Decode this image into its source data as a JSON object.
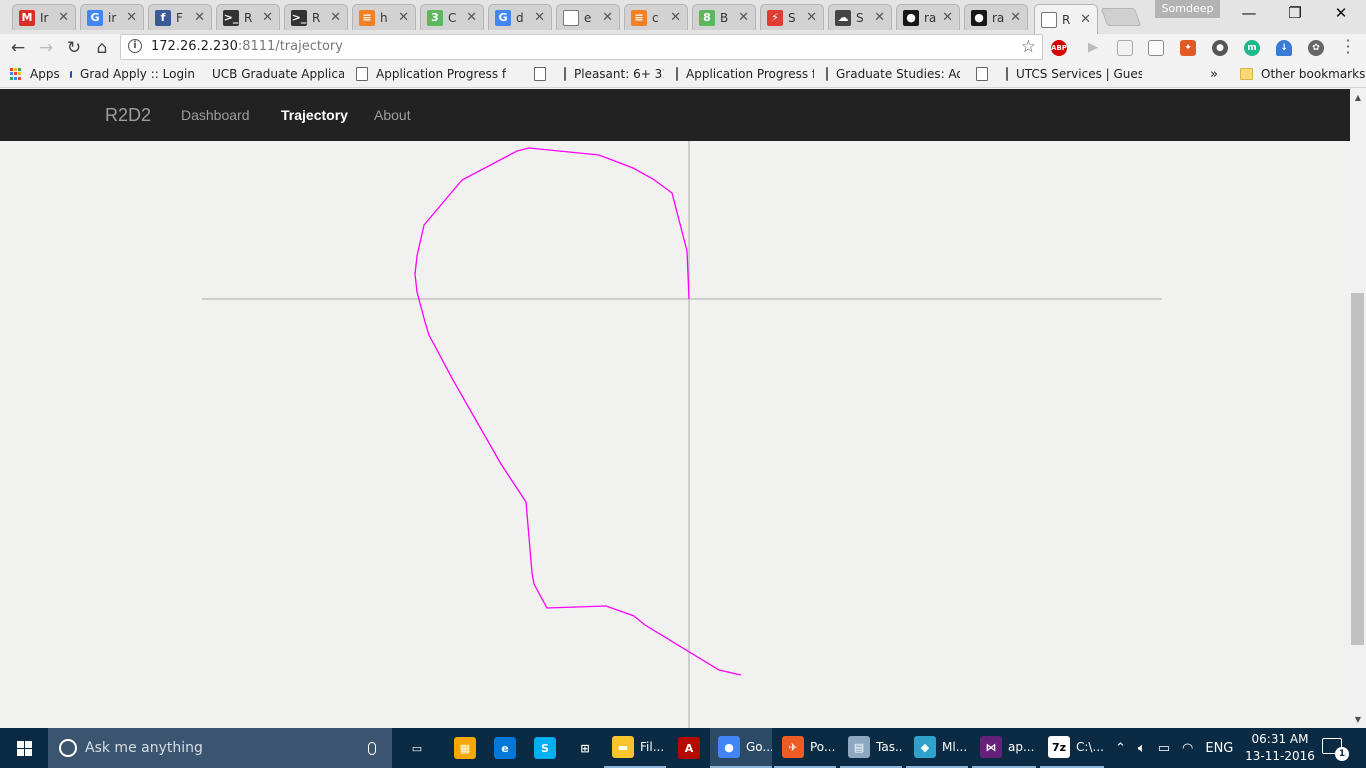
{
  "browser": {
    "tabs": [
      {
        "title": "Ir",
        "icon": "gmail-icon",
        "color": "#d93025",
        "glyph": "M"
      },
      {
        "title": "ir",
        "icon": "google-icon",
        "color": "#4285f4",
        "glyph": "G"
      },
      {
        "title": "F",
        "icon": "facebook-icon",
        "color": "#3b5998",
        "glyph": "f"
      },
      {
        "title": "R",
        "icon": "terminal-icon",
        "color": "#333333",
        "glyph": ">_"
      },
      {
        "title": "R",
        "icon": "terminal-icon",
        "color": "#333333",
        "glyph": ">_"
      },
      {
        "title": "h",
        "icon": "stackoverflow-icon",
        "color": "#f48024",
        "glyph": "≡"
      },
      {
        "title": "C",
        "icon": "codeship-icon",
        "color": "#5cb85c",
        "glyph": "3"
      },
      {
        "title": "d",
        "icon": "google-icon",
        "color": "#4285f4",
        "glyph": "G"
      },
      {
        "title": "e",
        "icon": "page-icon",
        "color": "#ffffff",
        "glyph": ""
      },
      {
        "title": "c",
        "icon": "stackoverflow-icon",
        "color": "#f48024",
        "glyph": "≡"
      },
      {
        "title": "B",
        "icon": "codeship-icon",
        "color": "#5cb85c",
        "glyph": "8"
      },
      {
        "title": "S",
        "icon": "lightning-icon",
        "color": "#e03c31",
        "glyph": "⚡"
      },
      {
        "title": "S",
        "icon": "cloud-icon",
        "color": "#444444",
        "glyph": "☁"
      },
      {
        "title": "ra",
        "icon": "github-icon",
        "color": "#181717",
        "glyph": "●"
      },
      {
        "title": "ra",
        "icon": "github-icon",
        "color": "#181717",
        "glyph": "●"
      },
      {
        "title": "R",
        "icon": "page-icon",
        "color": "#ffffff",
        "glyph": ""
      }
    ],
    "profile": "Somdeep",
    "url_host": "172.26.2.230",
    "url_path": ":8111/trajectory",
    "bookmarks": [
      {
        "label": "Apps",
        "kind": "apps"
      },
      {
        "label": "Grad Apply :: Login",
        "kind": "bird"
      },
      {
        "label": "UCB Graduate Applica",
        "kind": "cap"
      },
      {
        "label": "Application Progress f",
        "kind": "page"
      },
      {
        "label": "",
        "kind": "page"
      },
      {
        "label": "Pleasant: 6+ 31",
        "kind": "page"
      },
      {
        "label": "Application Progress f",
        "kind": "page"
      },
      {
        "label": "Graduate Studies: Adr",
        "kind": "page"
      },
      {
        "label": "",
        "kind": "page"
      },
      {
        "label": "UTCS Services | Guest",
        "kind": "page"
      }
    ],
    "bookmarks_overflow": "»",
    "other_bookmarks": "Other bookmarks"
  },
  "app": {
    "brand": "R2D2",
    "nav": [
      {
        "label": "Dashboard",
        "active": false
      },
      {
        "label": "Trajectory",
        "active": true
      },
      {
        "label": "About",
        "active": false
      }
    ]
  },
  "trajectory": {
    "stroke_color": "#ff00ff",
    "axis_color": "#aaaaaa",
    "points": [
      [
        0,
        0
      ],
      [
        -2,
        -48
      ],
      [
        -17,
        -106
      ],
      [
        -36,
        -120
      ],
      [
        -56,
        -131
      ],
      [
        -90,
        -144
      ],
      [
        -160,
        -151
      ],
      [
        -172,
        -148
      ],
      [
        -227,
        -119
      ],
      [
        -265,
        -74
      ],
      [
        -272,
        -43
      ],
      [
        -274,
        -25
      ],
      [
        -272,
        -7
      ],
      [
        -264,
        23
      ],
      [
        -260,
        36
      ],
      [
        -236,
        81
      ],
      [
        -188,
        165
      ],
      [
        -163,
        203
      ],
      [
        -157,
        274
      ],
      [
        -155,
        285
      ],
      [
        -142,
        309
      ],
      [
        -83,
        307
      ],
      [
        -55,
        317
      ],
      [
        -44,
        326
      ],
      [
        30,
        371
      ],
      [
        52,
        376
      ]
    ]
  },
  "taskbar": {
    "search_placeholder": "Ask me anything",
    "apps": [
      {
        "label": "",
        "icon": "task-view-icon",
        "color": "#0b2a43",
        "glyph": "▭"
      },
      {
        "label": "",
        "icon": "store-icon",
        "color": "#f8a800",
        "glyph": "▦"
      },
      {
        "label": "",
        "icon": "edge-icon",
        "color": "#0078d7",
        "glyph": "e"
      },
      {
        "label": "",
        "icon": "skype-icon",
        "color": "#00aff0",
        "glyph": "S"
      },
      {
        "label": "",
        "icon": "windows-store-icon",
        "color": "#0b2a43",
        "glyph": "⊞"
      },
      {
        "label": "Fil...",
        "icon": "file-explorer-icon",
        "color": "#f8c42c",
        "glyph": "▬"
      },
      {
        "label": "",
        "icon": "acrobat-icon",
        "color": "#b30b00",
        "glyph": "A"
      },
      {
        "label": "Go...",
        "icon": "chrome-icon",
        "color": "#4285f4",
        "glyph": "●"
      },
      {
        "label": "Po...",
        "icon": "postman-icon",
        "color": "#ef5b25",
        "glyph": "✈"
      },
      {
        "label": "Tas...",
        "icon": "task-manager-icon",
        "color": "#8fa8c2",
        "glyph": "▤"
      },
      {
        "label": "Ml...",
        "icon": "matlab-icon",
        "color": "#2ea2cc",
        "glyph": "◆"
      },
      {
        "label": "ap...",
        "icon": "visual-studio-icon",
        "color": "#68217a",
        "glyph": "⋈"
      },
      {
        "label": "C:\\...",
        "icon": "7zip-icon",
        "color": "#ffffff",
        "glyph": "7z"
      }
    ],
    "language": "ENG",
    "time": "06:31 AM",
    "date": "13-11-2016",
    "notifications": "1"
  }
}
